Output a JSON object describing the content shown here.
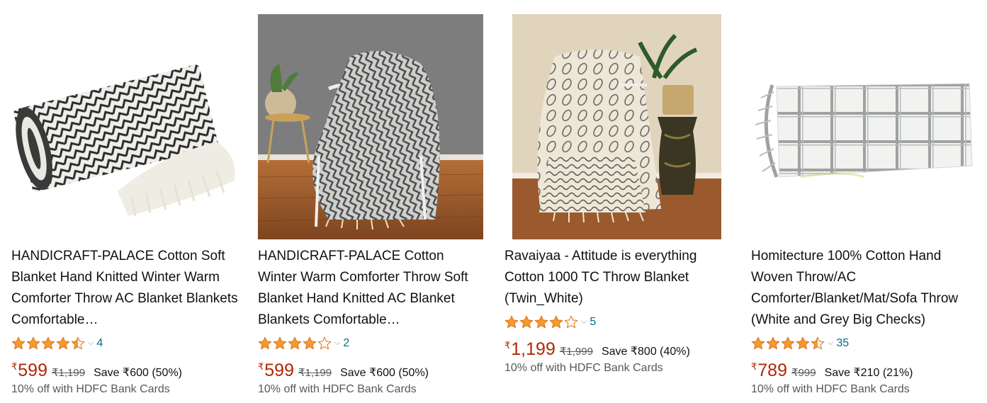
{
  "products": [
    {
      "title": "HANDICRAFT-PALACE Cotton Soft Blanket Hand Knitted Winter Warm Comforter Throw AC Blanket Blankets Comfortable…",
      "rating": 4.5,
      "rating_count": "4",
      "currency": "₹",
      "price": "599",
      "mrp": "₹1,199",
      "savings": "Save ₹600 (50%)",
      "offer": "10% off with HDFC Bank Cards",
      "image": "rolled-black-white-herringbone-throw"
    },
    {
      "title": "HANDICRAFT-PALACE Cotton Winter Warm Comforter Throw Soft Blanket Hand Knitted AC Blanket Blankets Comfortable…",
      "rating": 4,
      "rating_count": "2",
      "currency": "₹",
      "price": "599",
      "mrp": "₹1,199",
      "savings": "Save ₹600 (50%)",
      "offer": "10% off with HDFC Bank Cards",
      "image": "grey-throw-on-white-chair"
    },
    {
      "title": "Ravaiyaa - Attitude is everything Cotton 1000 TC Throw Blanket (Twin_White)",
      "rating": 4,
      "rating_count": "5",
      "currency": "₹",
      "price": "1,199",
      "mrp": "₹1,999",
      "savings": "Save ₹800 (40%)",
      "offer": "10% off with HDFC Bank Cards",
      "image": "white-leaf-print-throw-on-chair"
    },
    {
      "title": "Homitecture 100% Cotton Hand Woven Throw/AC Comforter/Blanket/Mat/Sofa Throw (White and Grey Big Checks)",
      "rating": 4.5,
      "rating_count": "35",
      "currency": "₹",
      "price": "789",
      "mrp": "₹999",
      "savings": "Save ₹210 (21%)",
      "offer": "10% off with HDFC Bank Cards",
      "image": "white-grey-check-throw"
    }
  ],
  "colors": {
    "price": "#B12704",
    "star": "#F69931",
    "link": "#007185",
    "muted": "#565959"
  }
}
